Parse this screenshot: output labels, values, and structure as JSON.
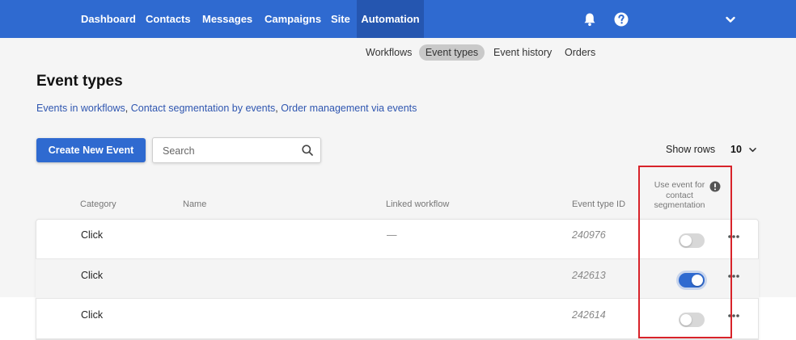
{
  "nav": {
    "items": [
      {
        "label": "Dashboard"
      },
      {
        "label": "Contacts"
      },
      {
        "label": "Messages"
      },
      {
        "label": "Campaigns"
      },
      {
        "label": "Site"
      },
      {
        "label": "Automation",
        "active": true
      }
    ],
    "icons": [
      "bell-icon",
      "help-icon",
      "chevron-down-icon"
    ]
  },
  "subnav": {
    "items": [
      {
        "label": "Workflows"
      },
      {
        "label": "Event types",
        "active": true
      },
      {
        "label": "Event history"
      },
      {
        "label": "Orders"
      }
    ]
  },
  "page": {
    "title": "Event types",
    "help_links": [
      "Events in workflows",
      "Contact segmentation by events",
      "Order management via events"
    ],
    "link_separator": ", "
  },
  "toolbar": {
    "create_label": "Create New Event",
    "search_placeholder": "Search",
    "show_rows_label": "Show rows",
    "show_rows_value": "10"
  },
  "table": {
    "headers": {
      "category": "Category",
      "name": "Name",
      "linked_workflow": "Linked workflow",
      "event_type_id": "Event type ID",
      "segmentation": "Use event for contact segmentation"
    },
    "rows": [
      {
        "category": "Click",
        "name": "",
        "linked_workflow": "—",
        "event_type_id": "240976",
        "segmentation": false
      },
      {
        "category": "Click",
        "name": "",
        "linked_workflow": "",
        "event_type_id": "242613",
        "segmentation": true
      },
      {
        "category": "Click",
        "name": "",
        "linked_workflow": "",
        "event_type_id": "242614",
        "segmentation": false
      }
    ]
  },
  "colors": {
    "brand": "#2f6ad0",
    "nav_active": "#2556b0",
    "link": "#2f56b0",
    "highlight": "#d8232a",
    "toggle_off": "#d8d8d8"
  }
}
